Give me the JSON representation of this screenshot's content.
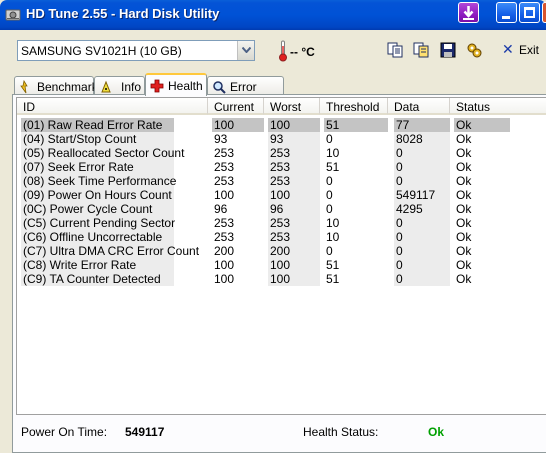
{
  "window": {
    "title": "HD Tune 2.55 - Hard Disk Utility"
  },
  "toolbar": {
    "drive": "SAMSUNG SV1021H (10 GB)",
    "temperature": "-- °C",
    "exit_label": "Exit"
  },
  "tabs": [
    {
      "label": "Benchmark",
      "icon": "benchmark-icon"
    },
    {
      "label": "Info",
      "icon": "info-icon"
    },
    {
      "label": "Health",
      "icon": "health-cross-icon",
      "active": true
    },
    {
      "label": "Error Scan",
      "icon": "error-scan-icon"
    }
  ],
  "columns": [
    "ID",
    "Current",
    "Worst",
    "Threshold",
    "Data",
    "Status"
  ],
  "rows": [
    {
      "id": "(01) Raw Read Error Rate",
      "current": "100",
      "worst": "100",
      "threshold": "51",
      "data": "77",
      "status": "Ok"
    },
    {
      "id": "(04) Start/Stop Count",
      "current": "93",
      "worst": "93",
      "threshold": "0",
      "data": "8028",
      "status": "Ok"
    },
    {
      "id": "(05) Reallocated Sector Count",
      "current": "253",
      "worst": "253",
      "threshold": "10",
      "data": "0",
      "status": "Ok"
    },
    {
      "id": "(07) Seek Error Rate",
      "current": "253",
      "worst": "253",
      "threshold": "51",
      "data": "0",
      "status": "Ok"
    },
    {
      "id": "(08) Seek Time Performance",
      "current": "253",
      "worst": "253",
      "threshold": "0",
      "data": "0",
      "status": "Ok"
    },
    {
      "id": "(09) Power On Hours Count",
      "current": "100",
      "worst": "100",
      "threshold": "0",
      "data": "549117",
      "status": "Ok"
    },
    {
      "id": "(0C) Power Cycle Count",
      "current": "96",
      "worst": "96",
      "threshold": "0",
      "data": "4295",
      "status": "Ok"
    },
    {
      "id": "(C5) Current Pending Sector",
      "current": "253",
      "worst": "253",
      "threshold": "10",
      "data": "0",
      "status": "Ok"
    },
    {
      "id": "(C6) Offline Uncorrectable",
      "current": "253",
      "worst": "253",
      "threshold": "10",
      "data": "0",
      "status": "Ok"
    },
    {
      "id": "(C7) Ultra DMA CRC Error Count",
      "current": "200",
      "worst": "200",
      "threshold": "0",
      "data": "0",
      "status": "Ok"
    },
    {
      "id": "(C8) Write Error Rate",
      "current": "100",
      "worst": "100",
      "threshold": "51",
      "data": "0",
      "status": "Ok"
    },
    {
      "id": "(C9) TA Counter Detected",
      "current": "100",
      "worst": "100",
      "threshold": "51",
      "data": "0",
      "status": "Ok"
    }
  ],
  "footer": {
    "power_on_label": "Power On Time:",
    "power_on_value": "549117",
    "health_label": "Health Status:",
    "health_value": "Ok",
    "health_color": "#00a000"
  }
}
